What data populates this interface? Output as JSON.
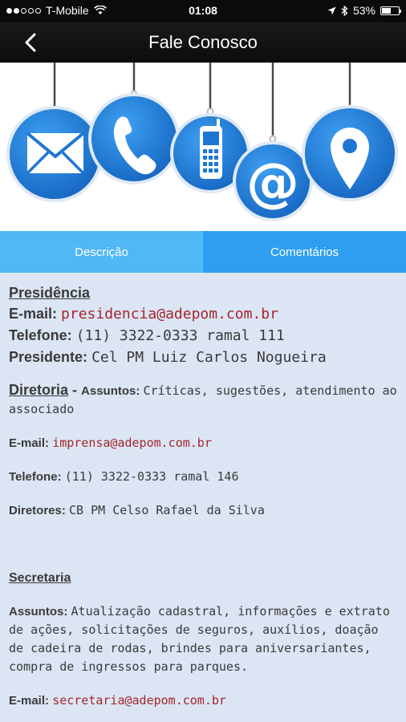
{
  "status_bar": {
    "carrier": "T-Mobile",
    "time": "01:08",
    "battery": "53%",
    "battery_level": 0.53
  },
  "nav": {
    "title": "Fale Conosco"
  },
  "banner": {
    "icons": [
      "envelope-icon",
      "phone-icon",
      "mobile-phone-icon",
      "at-sign-icon",
      "location-pin-icon"
    ],
    "at_symbol": "@"
  },
  "tabs": [
    {
      "label": "Descrição"
    },
    {
      "label": "Comentários"
    }
  ],
  "colors": {
    "tab_active": "#4fb8f5",
    "tab_inactive": "#2e9ff0",
    "link": "#a3272b",
    "content_bg": "#dce5f4",
    "icon_blue": "#1e88e5"
  },
  "presidencia": {
    "heading": "Presidência",
    "email_label": "E-mail:",
    "email": "presidencia@adepom.com.br",
    "phone_label": "Telefone:",
    "phone": "(11) 3322-0333 ramal 111",
    "president_label": "Presidente:",
    "president": "Cel PM Luiz Carlos Nogueira"
  },
  "diretoria": {
    "heading": "Diretoria",
    "dash": " - ",
    "subjects_label": "Assuntos:",
    "subjects": "Críticas, sugestões, atendimento ao associado",
    "email_label": "E-mail:",
    "email": "imprensa@adepom.com.br",
    "phone_label": "Telefone:",
    "phone": "(11) 3322-0333 ramal 146",
    "directors_label": "Diretores:",
    "directors": "CB PM Celso Rafael da Silva"
  },
  "secretaria": {
    "heading": "Secretaria",
    "subjects_label": "Assuntos:",
    "subjects": "Atualização cadastral, informações e extrato de ações, solicitações de seguros, auxílios, doação de cadeira de rodas, brindes para aniversariantes, compra de ingressos para parques.",
    "email_label": "E-mail:",
    "email": "secretaria@adepom.com.br"
  }
}
